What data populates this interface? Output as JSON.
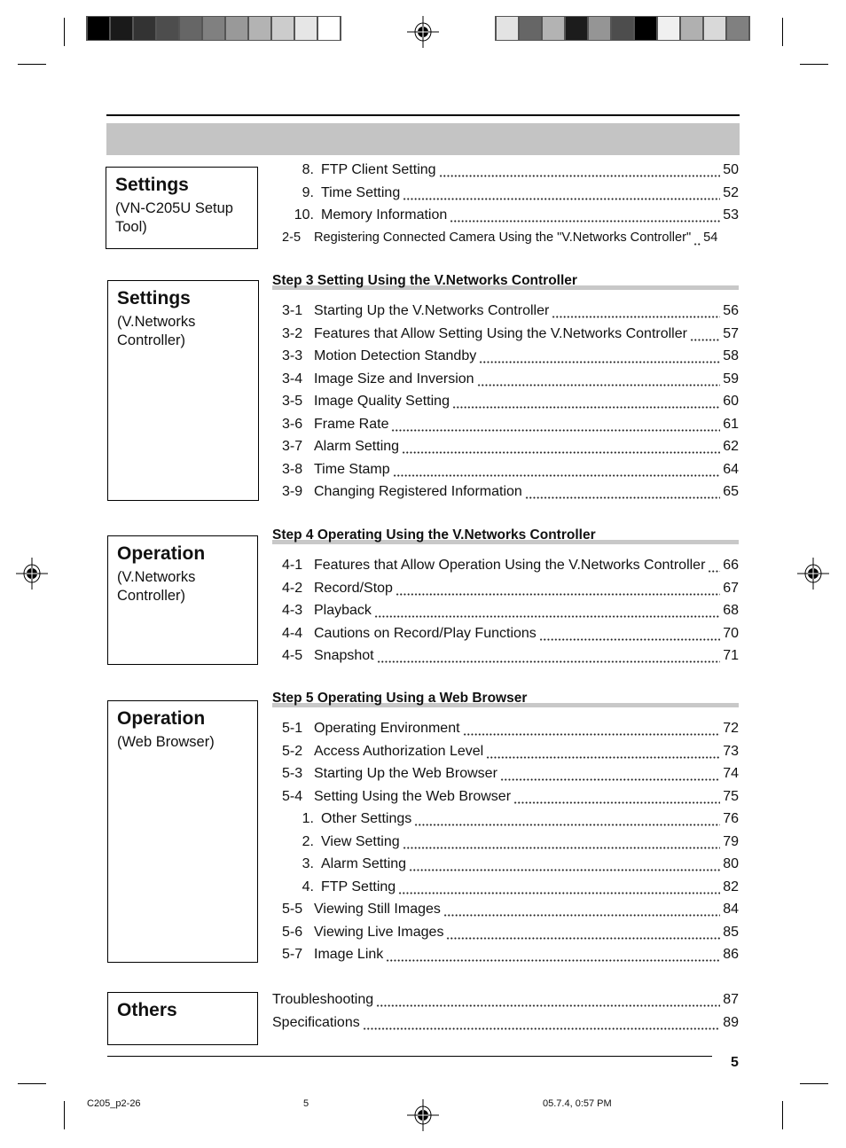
{
  "color_bars": {
    "left": [
      "#000000",
      "#1a1a1a",
      "#333333",
      "#4d4d4d",
      "#666666",
      "#808080",
      "#999999",
      "#b3b3b3",
      "#cccccc",
      "#e6e6e6",
      "#ffffff"
    ],
    "right": [
      "#e3e3e3",
      "#666666",
      "#b3b3b3",
      "#1c1c1c",
      "#959595",
      "#4d4d4d",
      "#000000",
      "#f0f0f0",
      "#b0b0b0",
      "#d9d9d9",
      "#808080"
    ]
  },
  "boxes": [
    {
      "title": "Settings",
      "subtitle": "(VN-C205U Setup Tool)"
    },
    {
      "title": "Settings",
      "subtitle": "(V.Networks Controller)"
    },
    {
      "title": "Operation",
      "subtitle": "(V.Networks Controller)"
    },
    {
      "title": "Operation",
      "subtitle": "(Web Browser)"
    },
    {
      "title": "Others",
      "subtitle": ""
    }
  ],
  "sections": [
    {
      "heading": "",
      "rows": [
        {
          "num": "8.",
          "title": "FTP Client Setting",
          "page": "50",
          "style": "sub"
        },
        {
          "num": "9.",
          "title": "Time Setting",
          "page": "52",
          "style": "sub"
        },
        {
          "num": "10.",
          "title": "Memory Information",
          "page": "53",
          "style": "sub"
        },
        {
          "num": "2-5",
          "title": "Registering Connected Camera Using the \"V.Networks Controller\"",
          "page": "54",
          "style": "small"
        }
      ]
    },
    {
      "heading": "Step 3 Setting Using the V.Networks Controller",
      "rows": [
        {
          "num": "3-1",
          "title": "Starting Up the V.Networks Controller",
          "page": "56"
        },
        {
          "num": "3-2",
          "title": "Features that Allow Setting Using the V.Networks Controller",
          "page": "57"
        },
        {
          "num": "3-3",
          "title": "Motion Detection Standby",
          "page": "58"
        },
        {
          "num": "3-4",
          "title": "Image Size and Inversion",
          "page": "59"
        },
        {
          "num": "3-5",
          "title": "Image Quality Setting",
          "page": "60"
        },
        {
          "num": "3-6",
          "title": "Frame Rate",
          "page": "61"
        },
        {
          "num": "3-7",
          "title": "Alarm Setting",
          "page": "62"
        },
        {
          "num": "3-8",
          "title": "Time Stamp",
          "page": "64"
        },
        {
          "num": "3-9",
          "title": "Changing Registered Information",
          "page": "65"
        }
      ]
    },
    {
      "heading": "Step 4 Operating Using the V.Networks Controller",
      "rows": [
        {
          "num": "4-1",
          "title": "Features that Allow Operation Using the V.Networks Controller",
          "page": "66"
        },
        {
          "num": "4-2",
          "title": "Record/Stop",
          "page": "67"
        },
        {
          "num": "4-3",
          "title": "Playback",
          "page": "68"
        },
        {
          "num": "4-4",
          "title": "Cautions on Record/Play Functions",
          "page": "70"
        },
        {
          "num": "4-5",
          "title": "Snapshot",
          "page": "71"
        }
      ]
    },
    {
      "heading": "Step 5 Operating Using a Web Browser",
      "rows": [
        {
          "num": "5-1",
          "title": "Operating Environment",
          "page": "72"
        },
        {
          "num": "5-2",
          "title": "Access Authorization Level",
          "page": "73"
        },
        {
          "num": "5-3",
          "title": "Starting Up the Web Browser",
          "page": "74"
        },
        {
          "num": "5-4",
          "title": "Setting Using the Web Browser",
          "page": "75"
        },
        {
          "num": "1.",
          "title": "Other Settings",
          "page": "76",
          "style": "sub"
        },
        {
          "num": "2.",
          "title": "View Setting",
          "page": "79",
          "style": "sub"
        },
        {
          "num": "3.",
          "title": "Alarm Setting",
          "page": "80",
          "style": "sub"
        },
        {
          "num": "4.",
          "title": "FTP Setting",
          "page": "82",
          "style": "sub"
        },
        {
          "num": "5-5",
          "title": "Viewing Still Images",
          "page": "84"
        },
        {
          "num": "5-6",
          "title": "Viewing Live Images",
          "page": "85"
        },
        {
          "num": "5-7",
          "title": "Image Link",
          "page": "86"
        }
      ]
    },
    {
      "heading": "",
      "rows": [
        {
          "num": "",
          "title": "Troubleshooting",
          "page": "87",
          "style": "plain"
        },
        {
          "num": "",
          "title": "Specifications",
          "page": "89",
          "style": "plain"
        }
      ]
    }
  ],
  "page_number": "5",
  "print_footer": {
    "file": "C205_p2-26",
    "page": "5",
    "timestamp": "05.7.4, 0:57 PM"
  }
}
